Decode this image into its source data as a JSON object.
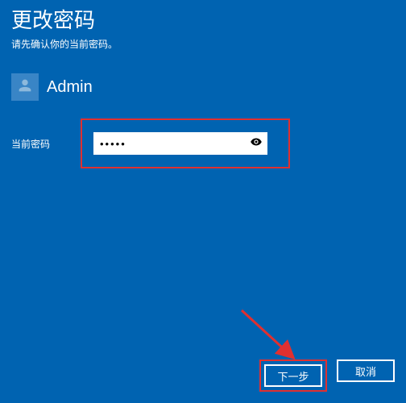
{
  "header": {
    "title": "更改密码",
    "subtitle": "请先确认你的当前密码。"
  },
  "user": {
    "name": "Admin"
  },
  "password": {
    "label": "当前密码",
    "value": "•••••"
  },
  "buttons": {
    "next": "下一步",
    "cancel": "取消"
  }
}
